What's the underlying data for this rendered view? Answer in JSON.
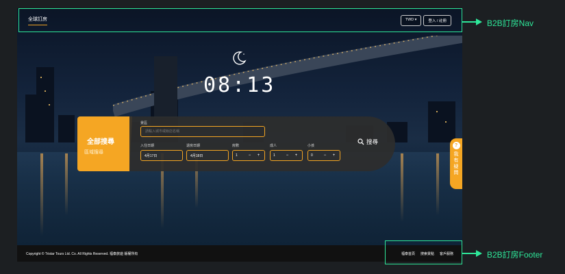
{
  "nav": {
    "brand": "全球訂房",
    "currency": "TWD ▾",
    "login": "登入 / 註冊"
  },
  "clock": {
    "time": "08:13"
  },
  "search": {
    "tab_all": "全部搜尋",
    "tab_region": "區域搜尋",
    "destination_label": "景區",
    "destination_placeholder": "請輸入城市或飯店名稱",
    "checkin_label": "入住日期",
    "checkin_value": "4月17日",
    "checkout_label": "退房日期",
    "checkout_value": "4月18日",
    "rooms_label": "房數",
    "rooms_value": "1",
    "adults_label": "成人",
    "adults_value": "1",
    "children_label": "小孩",
    "children_value": "0",
    "minus": "−",
    "plus": "+",
    "search_button": "搜尋"
  },
  "help_tab": {
    "q": "?",
    "text": "我有疑問"
  },
  "footer": {
    "copyright": "Copyright © Tristar Tours Ltd. Co. All Rights Reserved. 福泰旅遊 版權所有",
    "links": [
      "福泰首頁",
      "搜索景點",
      "客戶服務"
    ]
  },
  "annotations": {
    "nav_label": "B2B訂房Nav",
    "footer_label": "B2B訂房Footer"
  },
  "colors": {
    "accent": "#f5a623",
    "annotation": "#2ee89a",
    "page_bg": "#1c1f22"
  },
  "icons": [
    "moon-icon",
    "search-icon",
    "question-icon"
  ]
}
